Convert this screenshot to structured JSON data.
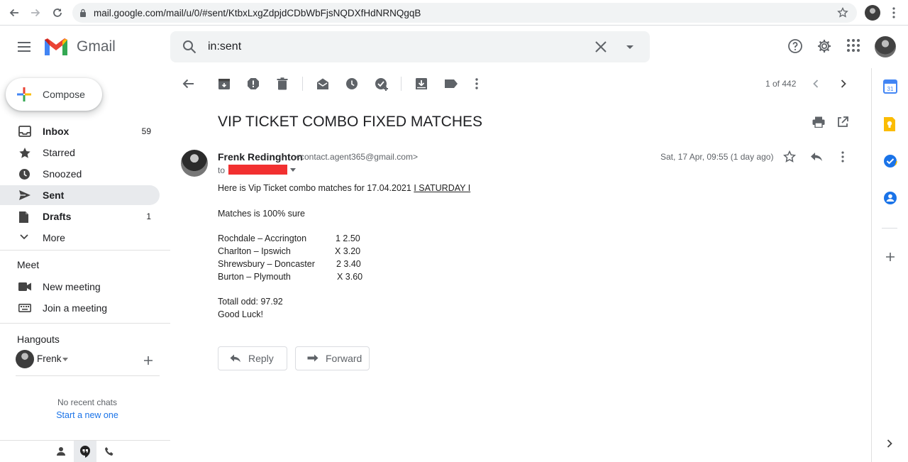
{
  "browser": {
    "url": "mail.google.com/mail/u/0/#sent/KtbxLxgZdpjdCDbWbFjsNQDXfHdNRNQgqB"
  },
  "header": {
    "app_name": "Gmail",
    "search_query": "in:sent"
  },
  "compose_label": "Compose",
  "nav": {
    "items": [
      {
        "label": "Inbox",
        "count": "59"
      },
      {
        "label": "Starred",
        "count": ""
      },
      {
        "label": "Snoozed",
        "count": ""
      },
      {
        "label": "Sent",
        "count": ""
      },
      {
        "label": "Drafts",
        "count": "1"
      },
      {
        "label": "More",
        "count": ""
      }
    ],
    "meet_title": "Meet",
    "meet_items": [
      "New meeting",
      "Join a meeting"
    ],
    "hangouts_title": "Hangouts",
    "hangouts_user": "Frenk",
    "no_chats": "No recent chats",
    "start_new": "Start a new one"
  },
  "toolbar": {
    "pager": "1 of 442"
  },
  "email": {
    "subject": "VIP TICKET COMBO FIXED MATCHES",
    "sender_name": "Frenk Redinghton",
    "sender_email": "<contact.agent365@gmail.com>",
    "to_label": "to",
    "date": "Sat, 17 Apr, 09:55 (1 day ago)",
    "intro_prefix": "Here is Vip Ticket combo matches for 17.04.2021 ",
    "intro_day": "I SATURDAY I",
    "sure_line": "Matches is 100% sure",
    "matches": [
      {
        "teams": "Rochdale – Accrington",
        "odd": "1 2.50"
      },
      {
        "teams": "Charlton – Ipswich",
        "odd": "X 3.20"
      },
      {
        "teams": "Shrewsbury – Doncaster",
        "odd": "2 3.40"
      },
      {
        "teams": "Burton – Plymouth",
        "odd": "X 3.60"
      }
    ],
    "total_odd": "Totall odd: 97.92",
    "good_luck": "Good Luck!",
    "reply_label": "Reply",
    "forward_label": "Forward"
  },
  "colors": {
    "accent_blue": "#1a73e8",
    "redaction": "#f23030",
    "active_nav": "#e8eaed"
  }
}
